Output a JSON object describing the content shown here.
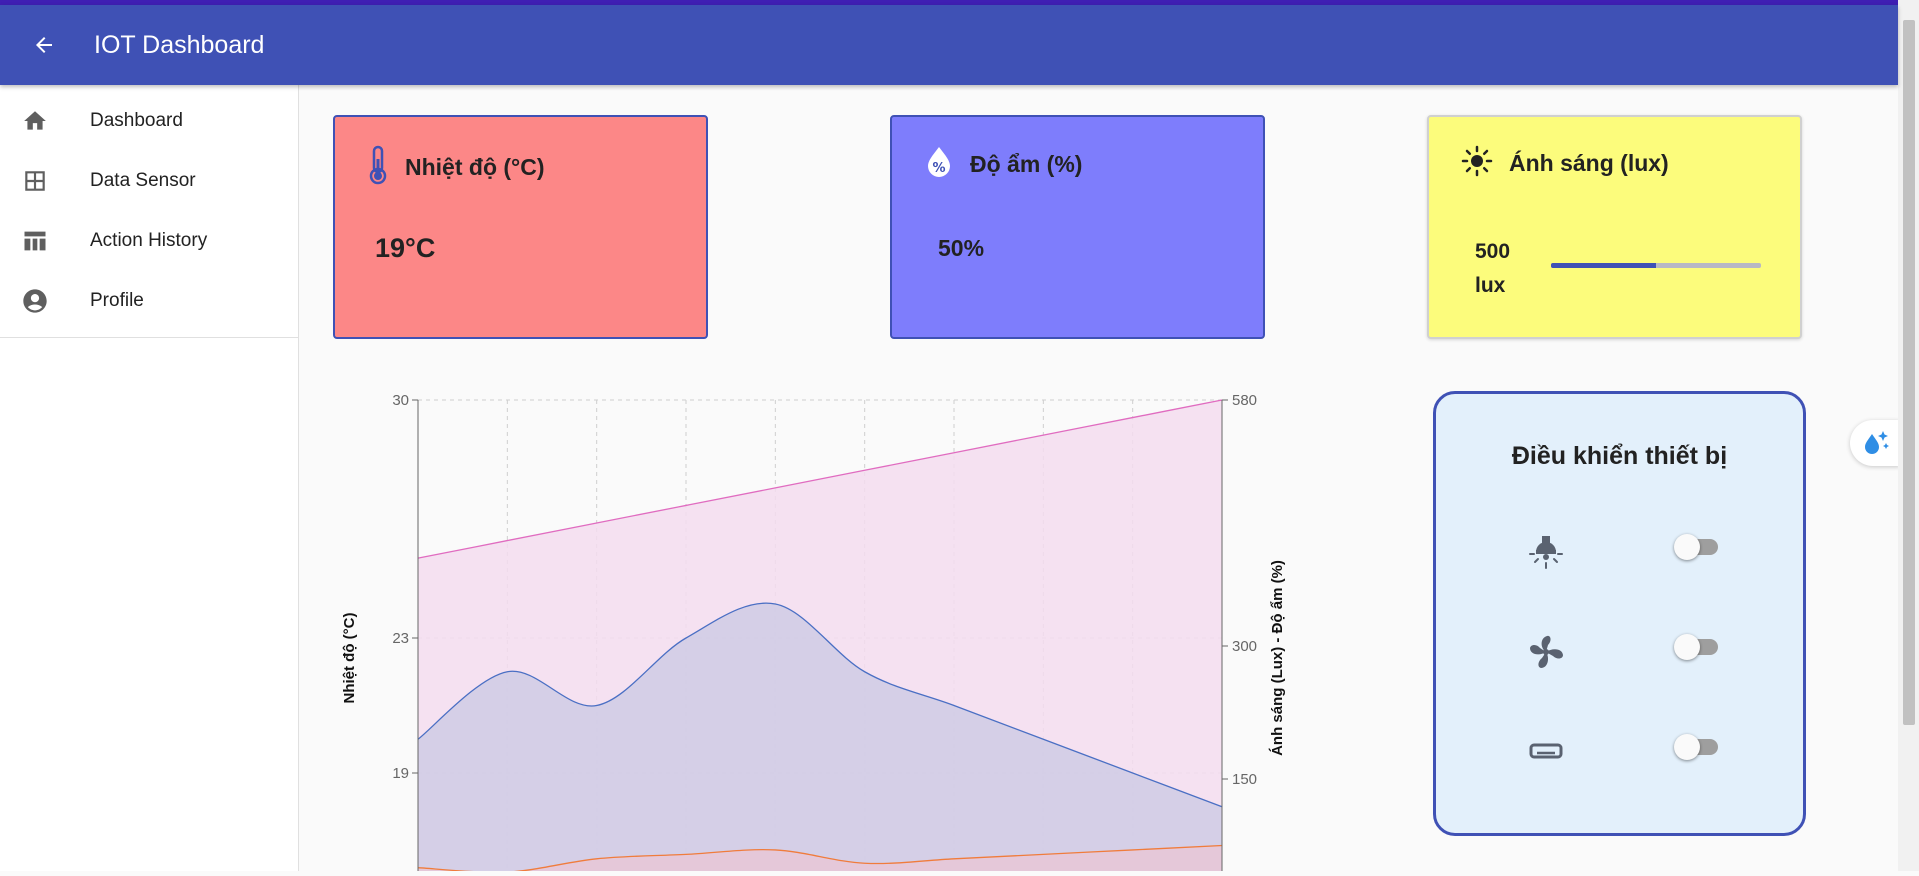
{
  "app": {
    "title": "IOT Dashboard",
    "accent": "#3f51b5"
  },
  "sidebar": {
    "items": [
      {
        "label": "Dashboard",
        "icon": "home-icon"
      },
      {
        "label": "Data Sensor",
        "icon": "grid-icon"
      },
      {
        "label": "Action History",
        "icon": "table-icon"
      },
      {
        "label": "Profile",
        "icon": "account-circle-icon"
      }
    ]
  },
  "cards": {
    "temperature": {
      "title": "Nhiệt độ (°C)",
      "value": "19°C",
      "color": "#fc8787",
      "icon": "thermometer-icon"
    },
    "humidity": {
      "title": "Độ ẩm (%)",
      "value": "50%",
      "color": "#7e7dfc",
      "icon": "water-percent-icon"
    },
    "light": {
      "title": "Ánh sáng (lux)",
      "value": "500 lux",
      "color": "#fcfc7c",
      "icon": "sun-icon",
      "level_percent": 50
    }
  },
  "control": {
    "title": "Điều khiển thiết bị",
    "devices": [
      {
        "icon": "light-bulb-icon",
        "on": false
      },
      {
        "icon": "fan-icon",
        "on": false
      },
      {
        "icon": "air-conditioner-icon",
        "on": false
      }
    ]
  },
  "chart_data": {
    "type": "area",
    "ylabel": "Nhiệt độ (°C)",
    "y2label": "Ánh sáng (Lux) - Độ ẩm (%)",
    "left_ticks": [
      "30",
      "23",
      "19"
    ],
    "right_ticks": [
      "580",
      "300",
      "150"
    ],
    "grid": true,
    "series": [
      {
        "axis": "right",
        "color": "#e06cc0",
        "fill": "#f3dcee",
        "values": [
          400,
          420,
          440,
          460,
          480,
          500,
          520,
          540,
          560,
          580
        ]
      },
      {
        "axis": "left",
        "color": "#4a6fc4",
        "fill": "#cfcbe5",
        "values": [
          20,
          22,
          21,
          23,
          24,
          22,
          21,
          20,
          19,
          18
        ]
      },
      {
        "axis": "right",
        "color": "#f07c3c",
        "fill": "#e8c7d6",
        "values": [
          50,
          45,
          60,
          65,
          70,
          55,
          60,
          65,
          70,
          75
        ]
      }
    ]
  }
}
